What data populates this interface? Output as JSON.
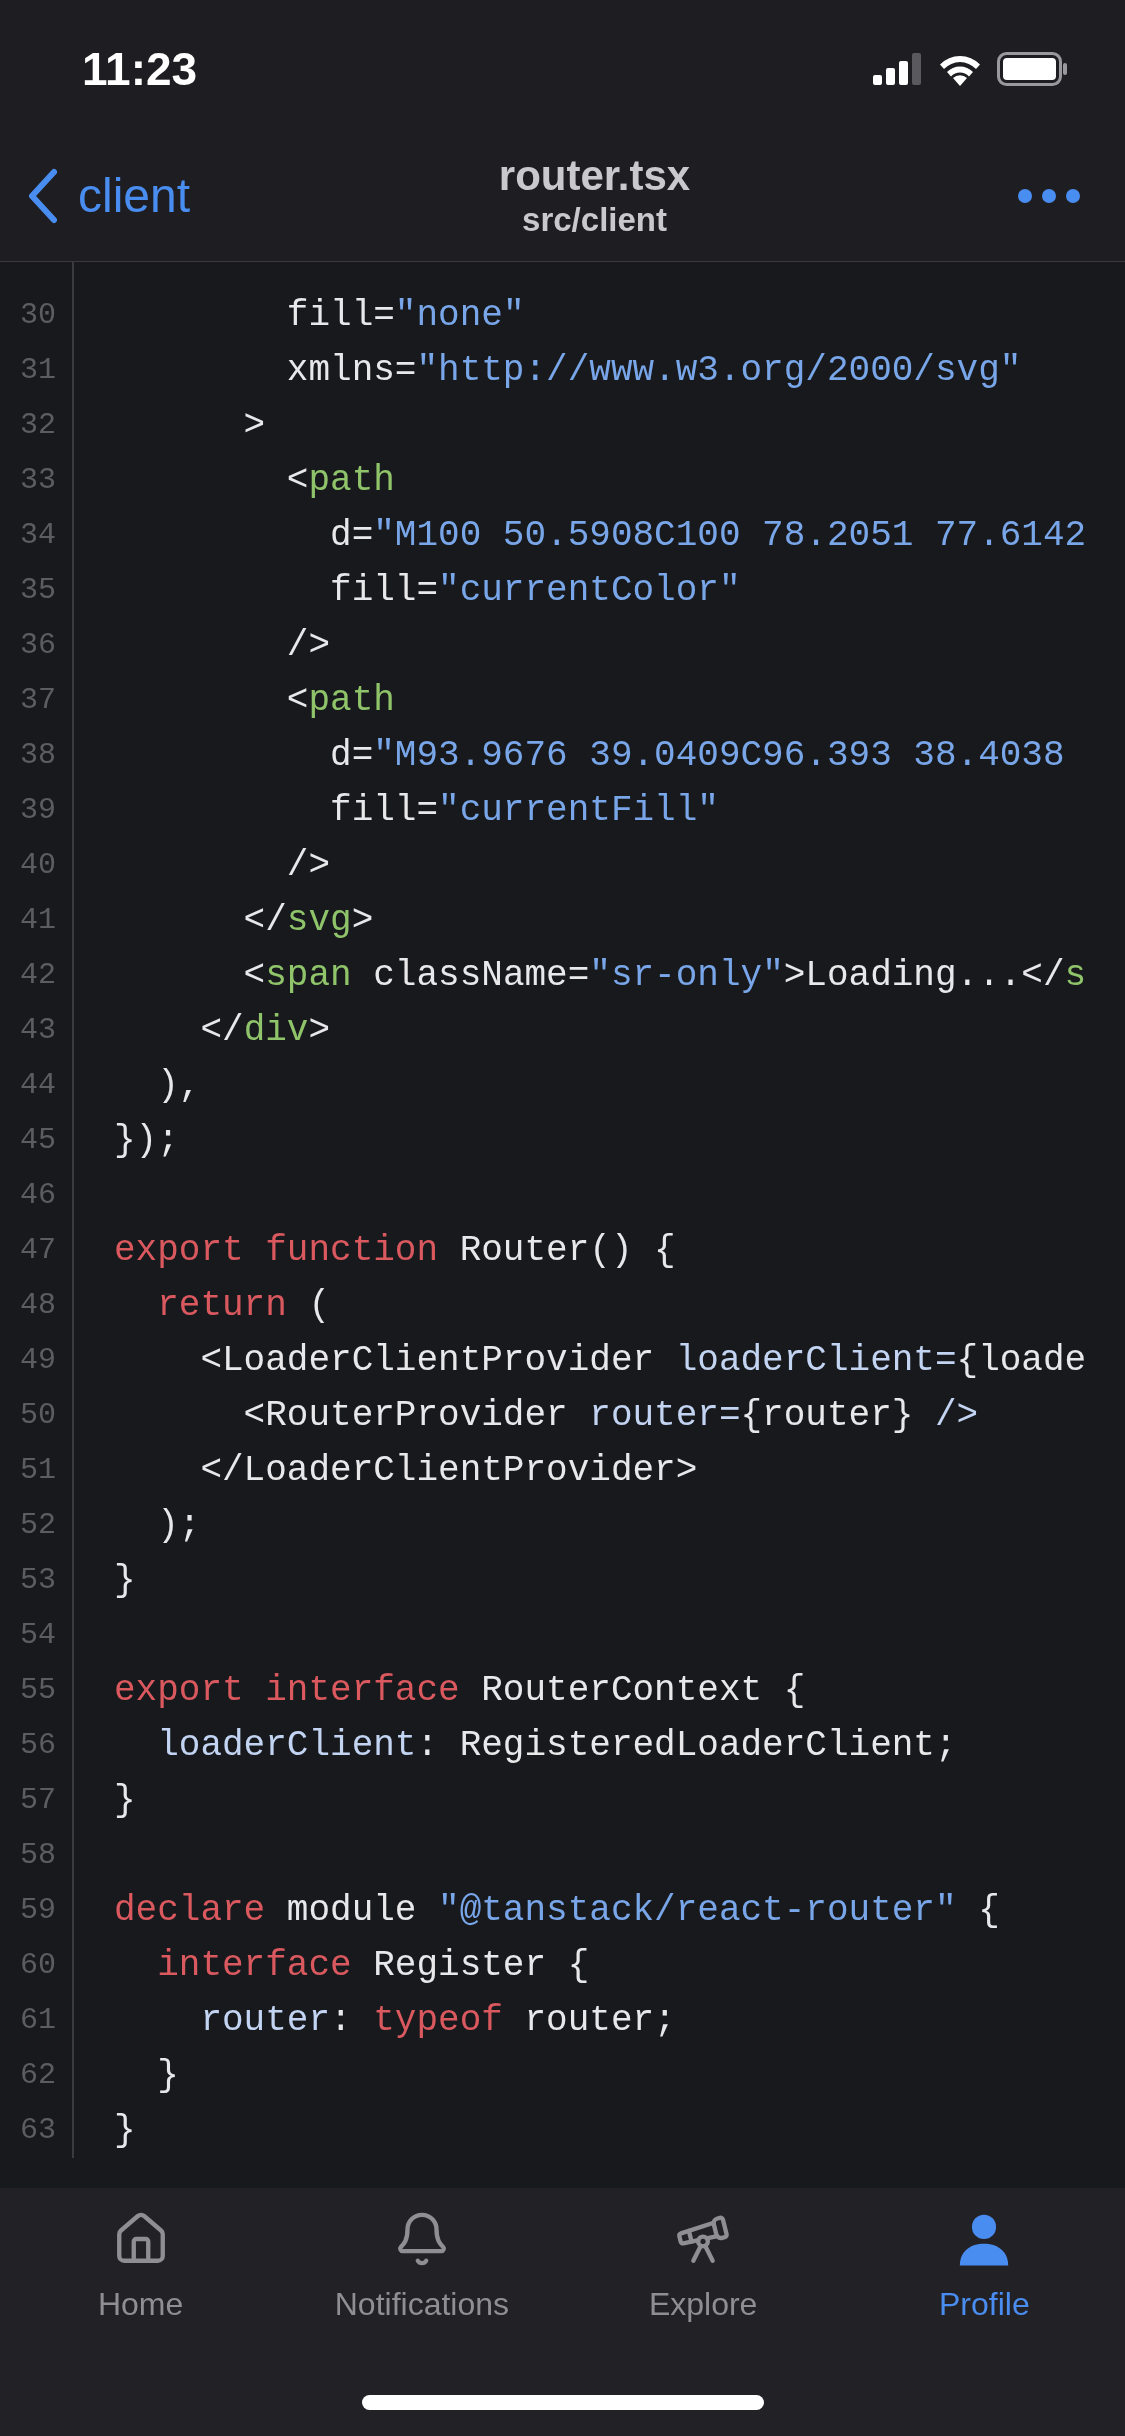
{
  "status_bar": {
    "time": "11:23"
  },
  "nav": {
    "back": "client",
    "title": "router.tsx",
    "subtitle": "src/client"
  },
  "code": [
    {
      "number": "30",
      "tokens": [
        {
          "text": "        fill=",
          "kind": "plain"
        },
        {
          "text": "\"none\"",
          "kind": "string"
        }
      ]
    },
    {
      "number": "31",
      "tokens": [
        {
          "text": "        xmlns=",
          "kind": "plain"
        },
        {
          "text": "\"http://www.w3.org/2000/svg\"",
          "kind": "string"
        }
      ]
    },
    {
      "number": "32",
      "tokens": [
        {
          "text": "      >",
          "kind": "plain"
        }
      ]
    },
    {
      "number": "33",
      "tokens": [
        {
          "text": "        <",
          "kind": "plain"
        },
        {
          "text": "path",
          "kind": "tag"
        }
      ]
    },
    {
      "number": "34",
      "tokens": [
        {
          "text": "          d=",
          "kind": "plain"
        },
        {
          "text": "\"M100 50.5908C100 78.2051 77.6142",
          "kind": "string"
        }
      ]
    },
    {
      "number": "35",
      "tokens": [
        {
          "text": "          fill=",
          "kind": "plain"
        },
        {
          "text": "\"currentColor\"",
          "kind": "string"
        }
      ]
    },
    {
      "number": "36",
      "tokens": [
        {
          "text": "        />",
          "kind": "plain"
        }
      ]
    },
    {
      "number": "37",
      "tokens": [
        {
          "text": "        <",
          "kind": "plain"
        },
        {
          "text": "path",
          "kind": "tag"
        }
      ]
    },
    {
      "number": "38",
      "tokens": [
        {
          "text": "          d=",
          "kind": "plain"
        },
        {
          "text": "\"M93.9676 39.0409C96.393 38.4038",
          "kind": "string"
        }
      ]
    },
    {
      "number": "39",
      "tokens": [
        {
          "text": "          fill=",
          "kind": "plain"
        },
        {
          "text": "\"currentFill\"",
          "kind": "string"
        }
      ]
    },
    {
      "number": "40",
      "tokens": [
        {
          "text": "        />",
          "kind": "plain"
        }
      ]
    },
    {
      "number": "41",
      "tokens": [
        {
          "text": "      </",
          "kind": "plain"
        },
        {
          "text": "svg",
          "kind": "tag"
        },
        {
          "text": ">",
          "kind": "plain"
        }
      ]
    },
    {
      "number": "42",
      "tokens": [
        {
          "text": "      <",
          "kind": "plain"
        },
        {
          "text": "span",
          "kind": "tag"
        },
        {
          "text": " className=",
          "kind": "plain"
        },
        {
          "text": "\"sr-only\"",
          "kind": "string"
        },
        {
          "text": ">Loading...</",
          "kind": "plain"
        },
        {
          "text": "s",
          "kind": "tag"
        }
      ]
    },
    {
      "number": "43",
      "tokens": [
        {
          "text": "    </",
          "kind": "plain"
        },
        {
          "text": "div",
          "kind": "tag"
        },
        {
          "text": ">",
          "kind": "plain"
        }
      ]
    },
    {
      "number": "44",
      "tokens": [
        {
          "text": "  ),",
          "kind": "plain"
        }
      ]
    },
    {
      "number": "45",
      "tokens": [
        {
          "text": "});",
          "kind": "plain"
        }
      ]
    },
    {
      "number": "46"
    },
    {
      "number": "47",
      "tokens": [
        {
          "text": "export function",
          "kind": "keyword"
        },
        {
          "text": " Router() {",
          "kind": "plain"
        }
      ]
    },
    {
      "number": "48",
      "tokens": [
        {
          "text": "  return",
          "kind": "keyword"
        },
        {
          "text": " (",
          "kind": "plain"
        }
      ]
    },
    {
      "number": "49",
      "tokens": [
        {
          "text": "    <LoaderClientProvider ",
          "kind": "plain"
        },
        {
          "text": "loaderClient=",
          "kind": "attr"
        },
        {
          "text": "{loade",
          "kind": "plain"
        }
      ]
    },
    {
      "number": "50",
      "tokens": [
        {
          "text": "      <RouterProvider ",
          "kind": "plain"
        },
        {
          "text": "router=",
          "kind": "attr"
        },
        {
          "text": "{router} ",
          "kind": "plain"
        },
        {
          "text": "/>",
          "kind": "attr"
        }
      ]
    },
    {
      "number": "51",
      "tokens": [
        {
          "text": "    </LoaderClientProvider>",
          "kind": "plain"
        }
      ]
    },
    {
      "number": "52",
      "tokens": [
        {
          "text": "  );",
          "kind": "plain"
        }
      ]
    },
    {
      "number": "53",
      "tokens": [
        {
          "text": "}",
          "kind": "plain"
        }
      ]
    },
    {
      "number": "54"
    },
    {
      "number": "55",
      "tokens": [
        {
          "text": "export interface",
          "kind": "keyword"
        },
        {
          "text": " RouterContext {",
          "kind": "plain"
        }
      ]
    },
    {
      "number": "56",
      "tokens": [
        {
          "text": "  loaderClient",
          "kind": "attr"
        },
        {
          "text": ": RegisteredLoaderClient;",
          "kind": "plain"
        }
      ]
    },
    {
      "number": "57",
      "tokens": [
        {
          "text": "}",
          "kind": "plain"
        }
      ]
    },
    {
      "number": "58"
    },
    {
      "number": "59",
      "tokens": [
        {
          "text": "declare",
          "kind": "keyword"
        },
        {
          "text": " module ",
          "kind": "plain"
        },
        {
          "text": "\"@tanstack/react-router\"",
          "kind": "string"
        },
        {
          "text": " {",
          "kind": "plain"
        }
      ]
    },
    {
      "number": "60",
      "tokens": [
        {
          "text": "  interface",
          "kind": "keyword"
        },
        {
          "text": " Register {",
          "kind": "plain"
        }
      ]
    },
    {
      "number": "61",
      "tokens": [
        {
          "text": "    router",
          "kind": "attr"
        },
        {
          "text": ": ",
          "kind": "plain"
        },
        {
          "text": "typeof",
          "kind": "keyword"
        },
        {
          "text": " router;",
          "kind": "plain"
        }
      ]
    },
    {
      "number": "62",
      "tokens": [
        {
          "text": "  }",
          "kind": "plain"
        }
      ]
    },
    {
      "number": "63",
      "tokens": [
        {
          "text": "}",
          "kind": "plain"
        }
      ]
    }
  ],
  "tabs": [
    {
      "label": "Home",
      "kind": "home",
      "selected": false
    },
    {
      "label": "Notifications",
      "kind": "bell",
      "selected": false
    },
    {
      "label": "Explore",
      "kind": "telescope",
      "selected": false
    },
    {
      "label": "Profile",
      "kind": "person",
      "selected": true
    }
  ]
}
